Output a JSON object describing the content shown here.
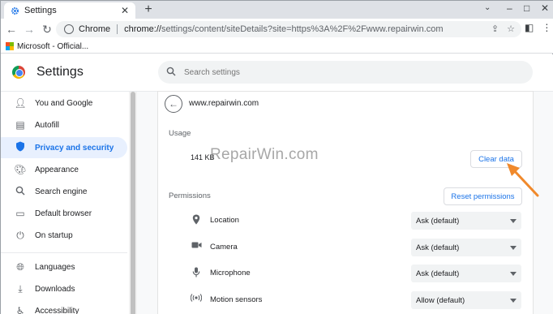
{
  "browser": {
    "tab_title": "Settings",
    "window_controls": [
      "–",
      "□",
      "✕"
    ],
    "chip_label": "Chrome",
    "url_prefix": "chrome://",
    "url_rest": "settings/content/siteDetails?site=https%3A%2F%2Fwww.repairwin.com",
    "bookmark_label": "Microsoft - Official..."
  },
  "settings": {
    "title": "Settings",
    "search_placeholder": "Search settings"
  },
  "sidebar": {
    "items": [
      {
        "label": "You and Google",
        "icon": "person-icon"
      },
      {
        "label": "Autofill",
        "icon": "clipboard-icon"
      },
      {
        "label": "Privacy and security",
        "icon": "shield-icon",
        "active": true
      },
      {
        "label": "Appearance",
        "icon": "palette-icon"
      },
      {
        "label": "Search engine",
        "icon": "search-icon"
      },
      {
        "label": "Default browser",
        "icon": "browser-icon"
      },
      {
        "label": "On startup",
        "icon": "power-icon"
      },
      {
        "label": "Languages",
        "icon": "globe-icon"
      },
      {
        "label": "Downloads",
        "icon": "download-icon"
      },
      {
        "label": "Accessibility",
        "icon": "accessibility-icon"
      }
    ]
  },
  "site_details": {
    "site": "www.repairwin.com",
    "usage_label": "Usage",
    "usage_value": "141 KB",
    "clear_data_label": "Clear data",
    "permissions_label": "Permissions",
    "reset_permissions_label": "Reset permissions",
    "watermark": "RepairWin.com",
    "permissions": [
      {
        "label": "Location",
        "value": "Ask (default)",
        "icon": "location-pin-icon"
      },
      {
        "label": "Camera",
        "value": "Ask (default)",
        "icon": "camera-icon"
      },
      {
        "label": "Microphone",
        "value": "Ask (default)",
        "icon": "microphone-icon"
      },
      {
        "label": "Motion sensors",
        "value": "Allow (default)",
        "icon": "motion-sensor-icon"
      }
    ]
  },
  "colors": {
    "accent": "#1a73e8",
    "annotation_arrow": "#f0892b"
  }
}
